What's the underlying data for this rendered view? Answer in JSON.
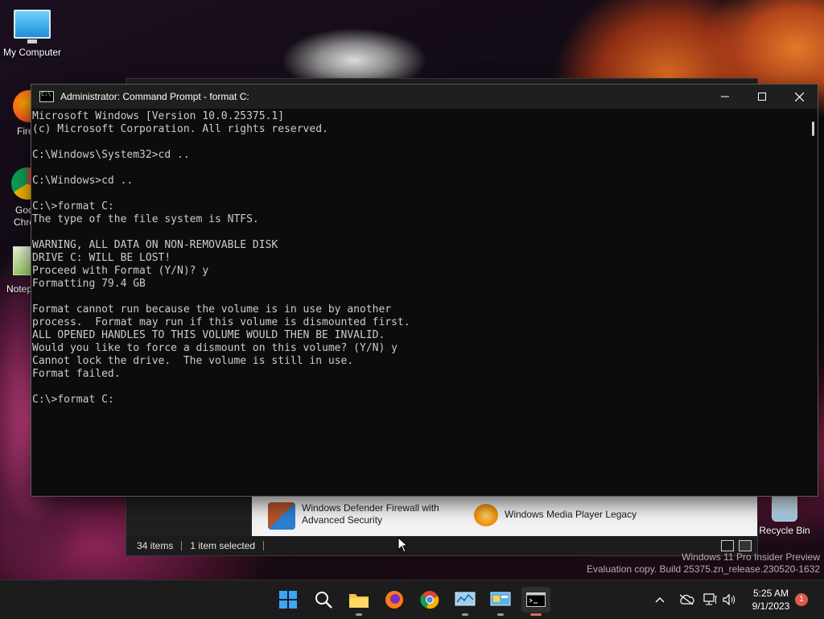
{
  "desktop": {
    "my_computer": "My Computer",
    "firefox_partial": "Fire",
    "chrome_partial_1": "Goo",
    "chrome_partial_2": "Chro",
    "notepad_partial": "Notep",
    "recycle_bin": "Recycle Bin"
  },
  "explorer": {
    "items": [
      {
        "label_1": "Windows Defender Firewall with",
        "label_2": "Advanced Security"
      },
      {
        "label_1": "Windows Media Player Legacy"
      }
    ],
    "status_items": "34 items",
    "status_selected": "1 item selected"
  },
  "cmd": {
    "title": "Administrator: Command Prompt - format  C:",
    "lines": [
      "Microsoft Windows [Version 10.0.25375.1]",
      "(c) Microsoft Corporation. All rights reserved.",
      "",
      "C:\\Windows\\System32>cd ..",
      "",
      "C:\\Windows>cd ..",
      "",
      "C:\\>format C:",
      "The type of the file system is NTFS.",
      "",
      "WARNING, ALL DATA ON NON-REMOVABLE DISK",
      "DRIVE C: WILL BE LOST!",
      "Proceed with Format (Y/N)? y",
      "Formatting 79.4 GB",
      "",
      "Format cannot run because the volume is in use by another",
      "process.  Format may run if this volume is dismounted first.",
      "ALL OPENED HANDLES TO THIS VOLUME WOULD THEN BE INVALID.",
      "Would you like to force a dismount on this volume? (Y/N) y",
      "Cannot lock the drive.  The volume is still in use.",
      "Format failed.",
      "",
      "C:\\>format C:"
    ]
  },
  "watermark": {
    "line1": "Windows 11 Pro Insider Preview",
    "line2": "Evaluation copy. Build 25375.zn_release.230520-1632"
  },
  "taskbar": {
    "time": "5:25 AM",
    "date": "9/1/2023",
    "notification_count": "1"
  },
  "colors": {
    "console_bg": "#0c0c0c",
    "console_fg": "#cccccc",
    "taskbar_bg": "#1c1c1c",
    "active_indicator": "#e06c5c"
  }
}
